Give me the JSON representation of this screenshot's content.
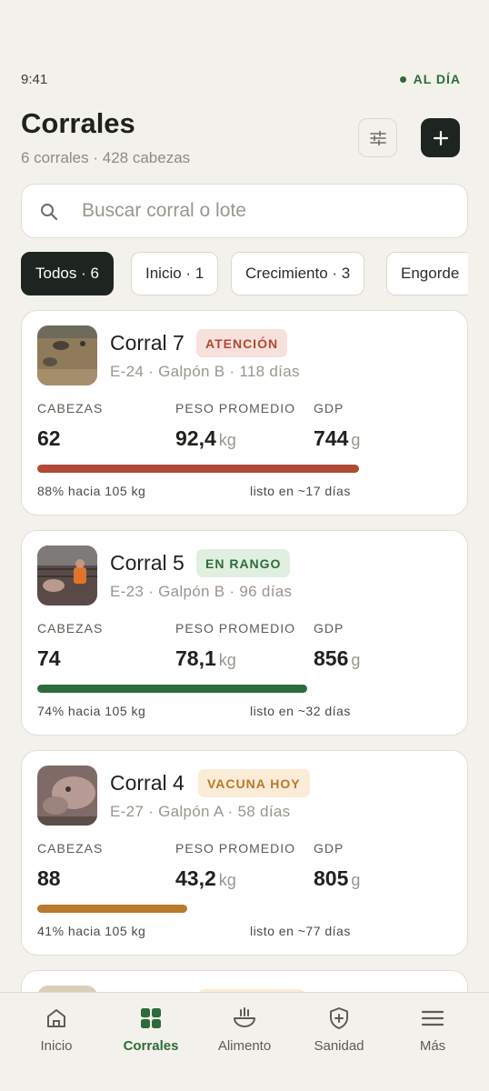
{
  "status_bar": {
    "time": "9:41",
    "sync": "AL DÍA"
  },
  "header": {
    "title": "Corrales",
    "subtitle": "6 corrales · 428 cabezas"
  },
  "search": {
    "placeholder": "Buscar corral o lote"
  },
  "filters": [
    {
      "label": "Todos · 6",
      "active": true
    },
    {
      "label": "Inicio · 1",
      "active": false
    },
    {
      "label": "Crecimiento · 3",
      "active": false
    },
    {
      "label": "Engorde",
      "active": false
    }
  ],
  "stat_labels": {
    "heads": "CABEZAS",
    "avg_weight": "PESO PROMEDIO",
    "gdp": "GDP"
  },
  "units": {
    "weight": "kg",
    "gdp": "g"
  },
  "pens": [
    {
      "name": "Corral 7",
      "badge": "ATENCIÓN",
      "meta": "E-24 · Galpón B · 118 días",
      "heads": "62",
      "avg_weight": "92,4",
      "gdp": "744",
      "progress": 0.88,
      "progress_text": "88% hacia 105 kg",
      "ready_text": "listo en ~17 días"
    },
    {
      "name": "Corral 5",
      "badge": "EN RANGO",
      "meta": "E-23 · Galpón B · 96 días",
      "heads": "74",
      "avg_weight": "78,1",
      "gdp": "856",
      "progress": 0.74,
      "progress_text": "74% hacia 105 kg",
      "ready_text": "listo en ~32 días"
    },
    {
      "name": "Corral 4",
      "badge": "VACUNA HOY",
      "meta": "E-27 · Galpón A · 58 días",
      "heads": "88",
      "avg_weight": "43,2",
      "gdp": "805",
      "progress": 0.41,
      "progress_text": "41% hacia 105 kg",
      "ready_text": "listo en ~77 días"
    }
  ],
  "colors": {
    "attention": "#b04a36",
    "attention_bg": "#f7e1dc",
    "in_range": "#2e6b3b",
    "in_range_bg": "#e1efe1",
    "vaccine": "#b87a2c",
    "vaccine_bg": "#fbecd7"
  },
  "nav": [
    {
      "label": "Inicio",
      "icon": "home-icon",
      "active": false
    },
    {
      "label": "Corrales",
      "icon": "grid-icon",
      "active": true
    },
    {
      "label": "Alimento",
      "icon": "feed-bowl-icon",
      "active": false
    },
    {
      "label": "Sanidad",
      "icon": "health-shield-icon",
      "active": false
    },
    {
      "label": "Más",
      "icon": "menu-icon",
      "active": false
    }
  ]
}
